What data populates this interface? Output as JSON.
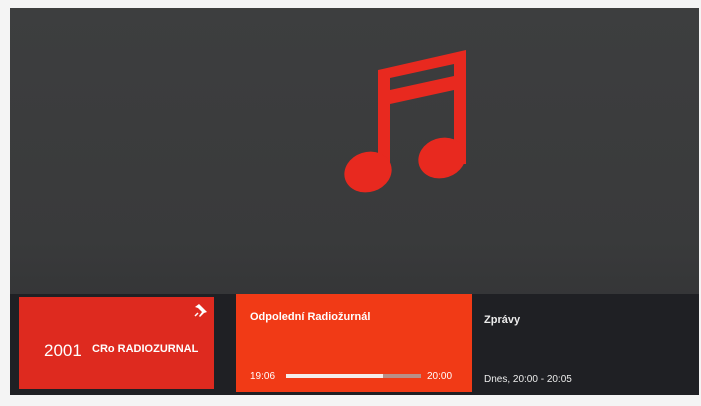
{
  "accent_colors": {
    "channel_tile": "#de2a1f",
    "now_tile": "#f13a16",
    "music_icon": "#e8291f",
    "background": "#3a3a3a"
  },
  "player": {
    "icon": "music-note-icon"
  },
  "channel": {
    "number": "2001",
    "name": "CRo RADIOZURNAL",
    "pin_icon": "pin-icon"
  },
  "now_playing": {
    "title": "Odpolední Radiožurnál",
    "start_time": "19:06",
    "end_time": "20:00",
    "progress": 0.72
  },
  "next_program": {
    "title": "Zprávy",
    "time": "Dnes, 20:00 - 20:05"
  }
}
